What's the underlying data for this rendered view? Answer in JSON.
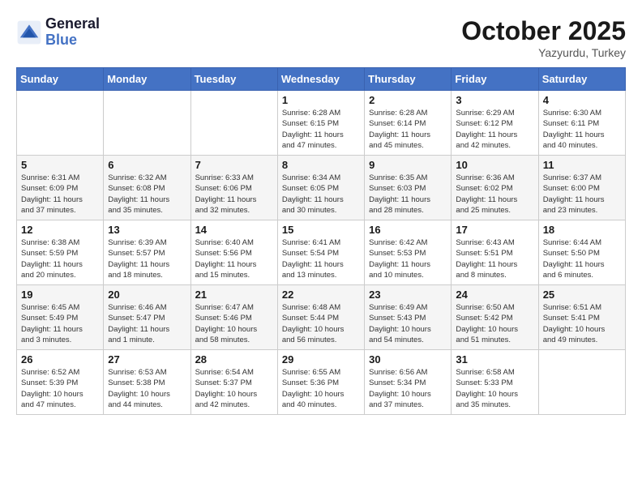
{
  "header": {
    "logo_line1": "General",
    "logo_line2": "Blue",
    "month": "October 2025",
    "location": "Yazyurdu, Turkey"
  },
  "weekdays": [
    "Sunday",
    "Monday",
    "Tuesday",
    "Wednesday",
    "Thursday",
    "Friday",
    "Saturday"
  ],
  "rows": [
    [
      {
        "day": "",
        "info": ""
      },
      {
        "day": "",
        "info": ""
      },
      {
        "day": "",
        "info": ""
      },
      {
        "day": "1",
        "info": "Sunrise: 6:28 AM\nSunset: 6:15 PM\nDaylight: 11 hours\nand 47 minutes."
      },
      {
        "day": "2",
        "info": "Sunrise: 6:28 AM\nSunset: 6:14 PM\nDaylight: 11 hours\nand 45 minutes."
      },
      {
        "day": "3",
        "info": "Sunrise: 6:29 AM\nSunset: 6:12 PM\nDaylight: 11 hours\nand 42 minutes."
      },
      {
        "day": "4",
        "info": "Sunrise: 6:30 AM\nSunset: 6:11 PM\nDaylight: 11 hours\nand 40 minutes."
      }
    ],
    [
      {
        "day": "5",
        "info": "Sunrise: 6:31 AM\nSunset: 6:09 PM\nDaylight: 11 hours\nand 37 minutes."
      },
      {
        "day": "6",
        "info": "Sunrise: 6:32 AM\nSunset: 6:08 PM\nDaylight: 11 hours\nand 35 minutes."
      },
      {
        "day": "7",
        "info": "Sunrise: 6:33 AM\nSunset: 6:06 PM\nDaylight: 11 hours\nand 32 minutes."
      },
      {
        "day": "8",
        "info": "Sunrise: 6:34 AM\nSunset: 6:05 PM\nDaylight: 11 hours\nand 30 minutes."
      },
      {
        "day": "9",
        "info": "Sunrise: 6:35 AM\nSunset: 6:03 PM\nDaylight: 11 hours\nand 28 minutes."
      },
      {
        "day": "10",
        "info": "Sunrise: 6:36 AM\nSunset: 6:02 PM\nDaylight: 11 hours\nand 25 minutes."
      },
      {
        "day": "11",
        "info": "Sunrise: 6:37 AM\nSunset: 6:00 PM\nDaylight: 11 hours\nand 23 minutes."
      }
    ],
    [
      {
        "day": "12",
        "info": "Sunrise: 6:38 AM\nSunset: 5:59 PM\nDaylight: 11 hours\nand 20 minutes."
      },
      {
        "day": "13",
        "info": "Sunrise: 6:39 AM\nSunset: 5:57 PM\nDaylight: 11 hours\nand 18 minutes."
      },
      {
        "day": "14",
        "info": "Sunrise: 6:40 AM\nSunset: 5:56 PM\nDaylight: 11 hours\nand 15 minutes."
      },
      {
        "day": "15",
        "info": "Sunrise: 6:41 AM\nSunset: 5:54 PM\nDaylight: 11 hours\nand 13 minutes."
      },
      {
        "day": "16",
        "info": "Sunrise: 6:42 AM\nSunset: 5:53 PM\nDaylight: 11 hours\nand 10 minutes."
      },
      {
        "day": "17",
        "info": "Sunrise: 6:43 AM\nSunset: 5:51 PM\nDaylight: 11 hours\nand 8 minutes."
      },
      {
        "day": "18",
        "info": "Sunrise: 6:44 AM\nSunset: 5:50 PM\nDaylight: 11 hours\nand 6 minutes."
      }
    ],
    [
      {
        "day": "19",
        "info": "Sunrise: 6:45 AM\nSunset: 5:49 PM\nDaylight: 11 hours\nand 3 minutes."
      },
      {
        "day": "20",
        "info": "Sunrise: 6:46 AM\nSunset: 5:47 PM\nDaylight: 11 hours\nand 1 minute."
      },
      {
        "day": "21",
        "info": "Sunrise: 6:47 AM\nSunset: 5:46 PM\nDaylight: 10 hours\nand 58 minutes."
      },
      {
        "day": "22",
        "info": "Sunrise: 6:48 AM\nSunset: 5:44 PM\nDaylight: 10 hours\nand 56 minutes."
      },
      {
        "day": "23",
        "info": "Sunrise: 6:49 AM\nSunset: 5:43 PM\nDaylight: 10 hours\nand 54 minutes."
      },
      {
        "day": "24",
        "info": "Sunrise: 6:50 AM\nSunset: 5:42 PM\nDaylight: 10 hours\nand 51 minutes."
      },
      {
        "day": "25",
        "info": "Sunrise: 6:51 AM\nSunset: 5:41 PM\nDaylight: 10 hours\nand 49 minutes."
      }
    ],
    [
      {
        "day": "26",
        "info": "Sunrise: 6:52 AM\nSunset: 5:39 PM\nDaylight: 10 hours\nand 47 minutes."
      },
      {
        "day": "27",
        "info": "Sunrise: 6:53 AM\nSunset: 5:38 PM\nDaylight: 10 hours\nand 44 minutes."
      },
      {
        "day": "28",
        "info": "Sunrise: 6:54 AM\nSunset: 5:37 PM\nDaylight: 10 hours\nand 42 minutes."
      },
      {
        "day": "29",
        "info": "Sunrise: 6:55 AM\nSunset: 5:36 PM\nDaylight: 10 hours\nand 40 minutes."
      },
      {
        "day": "30",
        "info": "Sunrise: 6:56 AM\nSunset: 5:34 PM\nDaylight: 10 hours\nand 37 minutes."
      },
      {
        "day": "31",
        "info": "Sunrise: 6:58 AM\nSunset: 5:33 PM\nDaylight: 10 hours\nand 35 minutes."
      },
      {
        "day": "",
        "info": ""
      }
    ]
  ]
}
